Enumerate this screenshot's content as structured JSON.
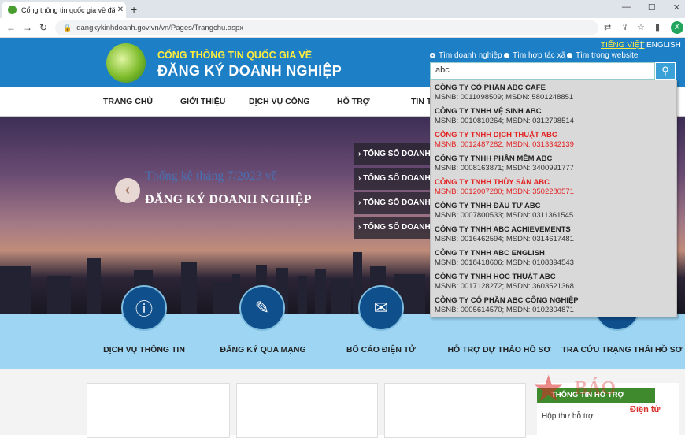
{
  "browser": {
    "tab_title": "Cổng thông tin quốc gia về đăng",
    "tab_close": "✕",
    "new_tab": "+",
    "url": "dangkykinhdoanh.gov.vn/vn/Pages/Trangchu.aspx",
    "profile_initial": "X",
    "icons": [
      "back-icon",
      "forward-icon",
      "reload-icon",
      "lock-icon",
      "translate-icon",
      "share-icon",
      "star-icon",
      "sidebar-icon"
    ]
  },
  "site": {
    "brand_line1": "CỔNG THÔNG TIN QUỐC GIA VỀ",
    "brand_line2": "ĐĂNG KÝ DOANH NGHIỆP",
    "lang_vi": "TIẾNG VIỆT",
    "lang_sep": "|",
    "lang_en": "ENGLISH",
    "radio_options": [
      "Tìm doanh nghiệp",
      "Tìm hợp tác xã",
      "Tìm trong website"
    ],
    "search_value": "abc",
    "colors": {
      "header": "#1d7fc6",
      "accent": "#ffec3d",
      "highlight": "#e32222",
      "support": "#3f8a2c"
    }
  },
  "menu": [
    "TRANG CHỦ",
    "GIỚI THIỆU",
    "DỊCH VỤ CÔNG",
    "HỖ TRỢ",
    "TIN T"
  ],
  "hero": {
    "subtitle": "Thống kê tháng 7/2023 về",
    "title": "ĐĂNG KÝ DOANH NGHIỆP",
    "prev_arrow": "‹",
    "stats": [
      "› TỔNG SỐ DOANH N",
      "› TỔNG SỐ DOANH N",
      "› TỔNG SỐ DOANH N",
      "› TỔNG SỐ DOANH N"
    ]
  },
  "services": [
    "DỊCH VỤ THÔNG TIN",
    "ĐĂNG KÝ QUA MẠNG",
    "BỐ CÁO ĐIỆN TỬ",
    "HỖ TRỢ DỰ THẢO HỒ SƠ",
    "TRA CỨU TRẠNG THÁI HỒ SƠ"
  ],
  "support": {
    "header": "THÔNG TIN HỖ TRỢ",
    "link": "Hộp thư hỗ trợ"
  },
  "watermark": {
    "main": "BÁO",
    "sub": "Điện tử"
  },
  "suggestions": [
    {
      "name": "CÔNG TY CỔ PHẦN ABC CAFE",
      "meta": "MSNB: 0011098509; MSDN: 5801248851",
      "highlight": false
    },
    {
      "name": "CÔNG TY TNHH VỆ SINH ABC",
      "meta": "MSNB: 0010810264; MSDN: 0312798514",
      "highlight": false
    },
    {
      "name": "CÔNG TY TNHH DỊCH THUẬT ABC",
      "meta": "MSNB: 0012487282; MSDN: 0313342139",
      "highlight": true
    },
    {
      "name": "CÔNG TY TNHH PHẦN MỀM ABC",
      "meta": "MSNB: 0008163871; MSDN: 3400991777",
      "highlight": false
    },
    {
      "name": "CÔNG TY TNHH THỦY SẢN ABC",
      "meta": "MSNB: 0012007280; MSDN: 3502280571",
      "highlight": true
    },
    {
      "name": "CÔNG TY TNHH ĐẦU TƯ ABC",
      "meta": "MSNB: 0007800533; MSDN: 0311361545",
      "highlight": false
    },
    {
      "name": "CÔNG TY TNHH ABC ACHIEVEMENTS",
      "meta": "MSNB: 0016462594; MSDN: 0314617481",
      "highlight": false
    },
    {
      "name": "CÔNG TY TNHH ABC ENGLISH",
      "meta": "MSNB: 0018418606; MSDN: 0108394543",
      "highlight": false
    },
    {
      "name": "CÔNG TY TNHH HỌC THUẬT ABC",
      "meta": "MSNB: 0017128272; MSDN: 3603521368",
      "highlight": false
    },
    {
      "name": "CÔNG TY CỔ PHẦN ABC CÔNG NGHIỆP",
      "meta": "MSNB: 0005614570; MSDN: 0102304871",
      "highlight": false
    }
  ]
}
